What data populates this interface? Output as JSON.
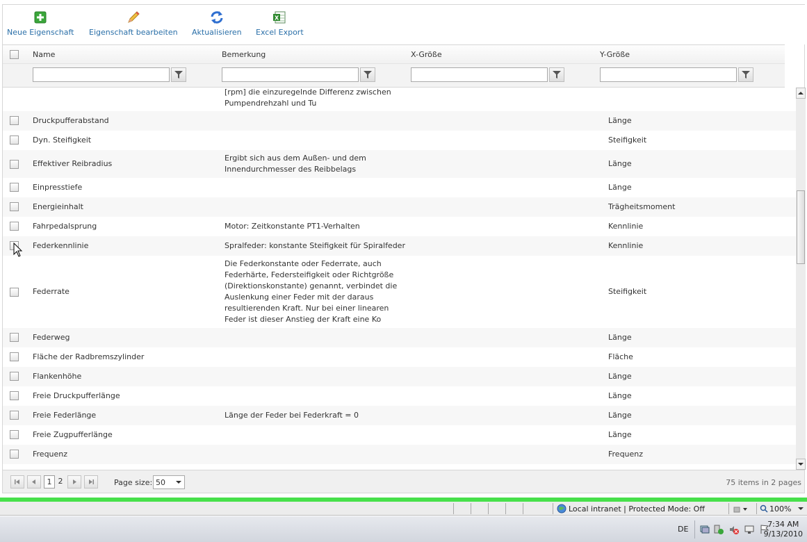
{
  "toolbar": {
    "new_label": "Neue Eigenschaft",
    "edit_label": "Eigenschaft bearbeiten",
    "refresh_label": "Aktualisieren",
    "export_label": "Excel Export"
  },
  "grid": {
    "columns": {
      "name": "Name",
      "remark": "Bemerkung",
      "x_size": "X-Größe",
      "y_size": "Y-Größe"
    },
    "partial_row": {
      "remark_line1": "[rpm] die einzuregelnde Differenz zwischen",
      "remark_line2": "Pumpendrehzahl und Tu"
    },
    "rows": [
      {
        "name": "Druckpufferabstand",
        "remark": "",
        "x": "",
        "y": "Länge"
      },
      {
        "name": "Dyn. Steifigkeit",
        "remark": "",
        "x": "",
        "y": "Steifigkeit"
      },
      {
        "name": "Effektiver Reibradius",
        "remark": "Ergibt sich aus dem Außen- und dem Innendurchmesser des Reibbelags",
        "x": "",
        "y": "Länge"
      },
      {
        "name": "Einpresstiefe",
        "remark": "",
        "x": "",
        "y": "Länge"
      },
      {
        "name": "Energieinhalt",
        "remark": "",
        "x": "",
        "y": "Trägheitsmoment"
      },
      {
        "name": "Fahrpedalsprung",
        "remark": "Motor: Zeitkonstante PT1-Verhalten",
        "x": "",
        "y": "Kennlinie"
      },
      {
        "name": "Federkennlinie",
        "remark": "Spralfeder: konstante Steifigkeit für Spiralfeder",
        "x": "",
        "y": "Kennlinie"
      },
      {
        "name": "Federrate",
        "remark": "Die Federkonstante oder Federrate, auch Federhärte, Federsteifigkeit oder Richtgröße (Direktionskonstante) genannt, verbindet die Auslenkung einer Feder mit der daraus resultierenden Kraft. Nur bei einer linearen Feder ist dieser Anstieg der Kraft eine Ko",
        "x": "",
        "y": "Steifigkeit"
      },
      {
        "name": "Federweg",
        "remark": "",
        "x": "",
        "y": "Länge"
      },
      {
        "name": "Fläche der Radbremszylinder",
        "remark": "",
        "x": "",
        "y": "Fläche"
      },
      {
        "name": "Flankenhöhe",
        "remark": "",
        "x": "",
        "y": "Länge"
      },
      {
        "name": "Freie Druckpufferlänge",
        "remark": "",
        "x": "",
        "y": "Länge"
      },
      {
        "name": "Freie Federlänge",
        "remark": "Länge der Feder bei Federkraft = 0",
        "x": "",
        "y": "Länge"
      },
      {
        "name": "Freie Zugpufferlänge",
        "remark": "",
        "x": "",
        "y": "Länge"
      },
      {
        "name": "Frequenz",
        "remark": "",
        "x": "",
        "y": "Frequenz"
      }
    ]
  },
  "pager": {
    "page1": "1",
    "page2": "2",
    "page_size_label": "Page size:",
    "page_size_value": "50",
    "info": "75 items in 2 pages"
  },
  "statusbar": {
    "zone": "Local intranet | Protected Mode: Off",
    "zoom": "100%"
  },
  "taskbar": {
    "lang": "DE",
    "time": "7:34 AM",
    "date": "9/13/2010"
  },
  "colors": {
    "link": "#2a6fa8",
    "accent_green": "#47e04a"
  }
}
